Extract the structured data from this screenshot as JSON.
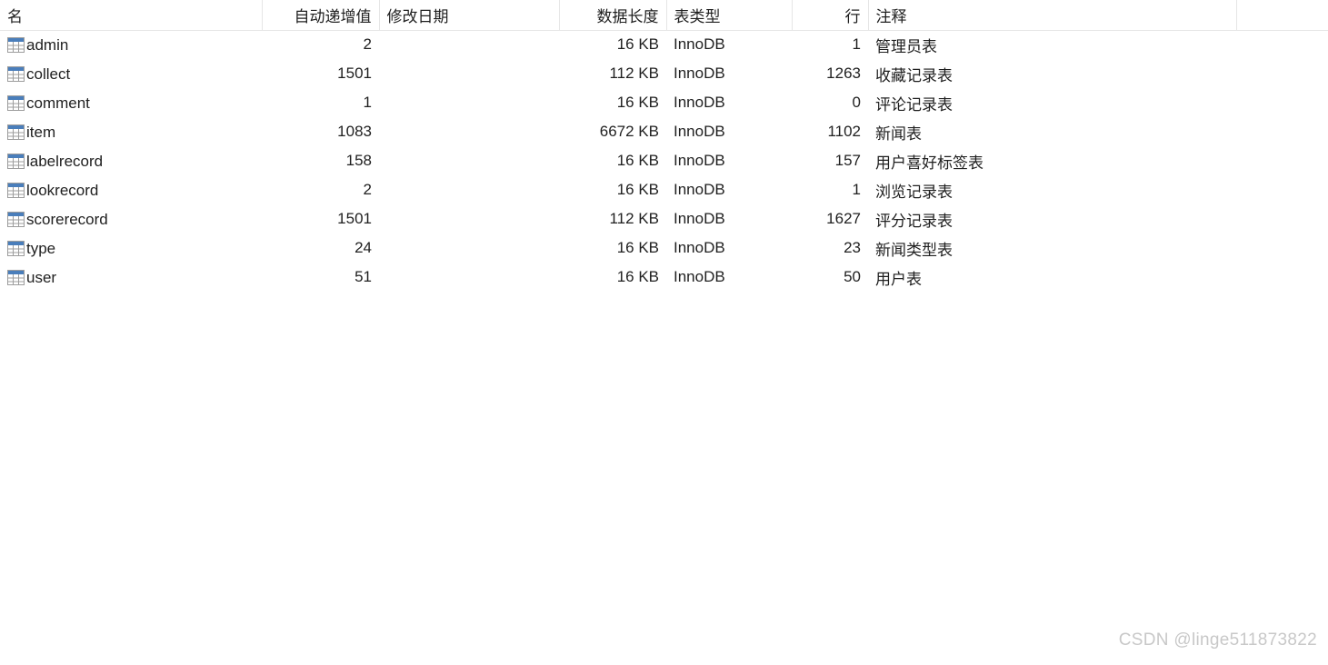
{
  "grid": {
    "columns": [
      {
        "key": "name",
        "label": "名",
        "align": "left"
      },
      {
        "key": "auto_inc",
        "label": "自动递增值",
        "align": "right"
      },
      {
        "key": "modified",
        "label": "修改日期",
        "align": "left"
      },
      {
        "key": "data_len",
        "label": "数据长度",
        "align": "right"
      },
      {
        "key": "table_type",
        "label": "表类型",
        "align": "left"
      },
      {
        "key": "rows",
        "label": "行",
        "align": "right"
      },
      {
        "key": "comment",
        "label": "注释",
        "align": "left"
      },
      {
        "key": "tail",
        "label": "",
        "align": "left"
      }
    ],
    "row_icon": "table-grid-icon",
    "rows": [
      {
        "name": "admin",
        "auto_inc": "2",
        "modified": "",
        "data_len": "16 KB",
        "table_type": "InnoDB",
        "rows": "1",
        "comment": "管理员表"
      },
      {
        "name": "collect",
        "auto_inc": "1501",
        "modified": "",
        "data_len": "112 KB",
        "table_type": "InnoDB",
        "rows": "1263",
        "comment": "收藏记录表"
      },
      {
        "name": "comment",
        "auto_inc": "1",
        "modified": "",
        "data_len": "16 KB",
        "table_type": "InnoDB",
        "rows": "0",
        "comment": "评论记录表"
      },
      {
        "name": "item",
        "auto_inc": "1083",
        "modified": "",
        "data_len": "6672 KB",
        "table_type": "InnoDB",
        "rows": "1102",
        "comment": "新闻表"
      },
      {
        "name": "labelrecord",
        "auto_inc": "158",
        "modified": "",
        "data_len": "16 KB",
        "table_type": "InnoDB",
        "rows": "157",
        "comment": "用户喜好标签表"
      },
      {
        "name": "lookrecord",
        "auto_inc": "2",
        "modified": "",
        "data_len": "16 KB",
        "table_type": "InnoDB",
        "rows": "1",
        "comment": "浏览记录表"
      },
      {
        "name": "scorerecord",
        "auto_inc": "1501",
        "modified": "",
        "data_len": "112 KB",
        "table_type": "InnoDB",
        "rows": "1627",
        "comment": "评分记录表"
      },
      {
        "name": "type",
        "auto_inc": "24",
        "modified": "",
        "data_len": "16 KB",
        "table_type": "InnoDB",
        "rows": "23",
        "comment": "新闻类型表"
      },
      {
        "name": "user",
        "auto_inc": "51",
        "modified": "",
        "data_len": "16 KB",
        "table_type": "InnoDB",
        "rows": "50",
        "comment": "用户表"
      }
    ]
  },
  "watermark": {
    "text": "CSDN @linge511873822"
  },
  "colors": {
    "background": "#ffffff",
    "text": "#1f1f1f",
    "grid_line": "#e6e6e6",
    "icon_header": "#4a7ebb",
    "icon_border": "#9d9d9d",
    "watermark": "#c8c8c8"
  }
}
